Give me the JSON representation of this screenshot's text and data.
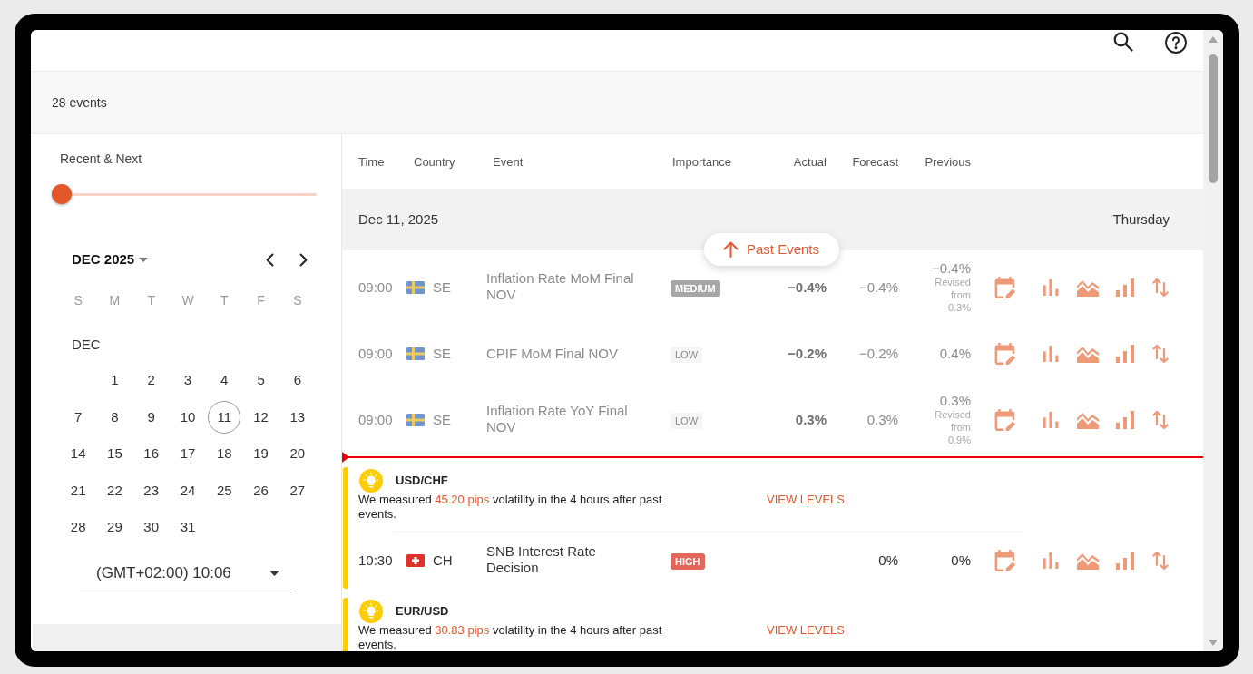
{
  "summary": {
    "event_count": "28 events"
  },
  "sidebar": {
    "range_label": "Recent & Next",
    "range_slider": {
      "level": 0
    },
    "calendar": {
      "month_title": "DEC 2025",
      "weekdays": [
        "S",
        "M",
        "T",
        "W",
        "T",
        "F",
        "S"
      ],
      "month_label": "DEC",
      "weeks": [
        {
          "days": [
            {
              "label": "1",
              "selected": false
            },
            {
              "label": "2",
              "selected": false
            },
            {
              "label": "3",
              "selected": false
            },
            {
              "label": "4",
              "selected": false
            },
            {
              "label": "5",
              "selected": false
            },
            {
              "label": "6",
              "selected": false
            }
          ]
        },
        {
          "days": [
            {
              "label": "7",
              "selected": false
            },
            {
              "label": "8",
              "selected": false
            },
            {
              "label": "9",
              "selected": false
            },
            {
              "label": "10",
              "selected": false
            },
            {
              "label": "11",
              "selected": true
            },
            {
              "label": "12",
              "selected": false
            },
            {
              "label": "13",
              "selected": false
            }
          ]
        },
        {
          "days": [
            {
              "label": "14",
              "selected": false
            },
            {
              "label": "15",
              "selected": false
            },
            {
              "label": "16",
              "selected": false
            },
            {
              "label": "17",
              "selected": false
            },
            {
              "label": "18",
              "selected": false
            },
            {
              "label": "19",
              "selected": false
            },
            {
              "label": "20",
              "selected": false
            }
          ]
        },
        {
          "days": [
            {
              "label": "21",
              "selected": false
            },
            {
              "label": "22",
              "selected": false
            },
            {
              "label": "23",
              "selected": false
            },
            {
              "label": "24",
              "selected": false
            },
            {
              "label": "25",
              "selected": false
            },
            {
              "label": "26",
              "selected": false
            },
            {
              "label": "27",
              "selected": false
            }
          ]
        },
        {
          "days": [
            {
              "label": "28",
              "selected": false
            },
            {
              "label": "29",
              "selected": false
            },
            {
              "label": "30",
              "selected": false
            },
            {
              "label": "31",
              "selected": false
            }
          ]
        }
      ]
    },
    "timezone": {
      "value": "(GMT+02:00) 10:06"
    }
  },
  "table": {
    "columns": [
      "Time",
      "Country",
      "Event",
      "Importance",
      "Actual",
      "Forecast",
      "Previous"
    ],
    "date_group": {
      "date": "Dec 11, 2025",
      "weekday": "Thursday"
    },
    "past_events_button": {
      "label": "Past Events"
    },
    "rows": [
      {
        "kind": "event",
        "past": true,
        "time": "09:00",
        "flag": {
          "kind": "sweden"
        },
        "country": "SE",
        "event": "Inflation Rate MoM Final NOV",
        "importance": {
          "label": "MEDIUM",
          "kind": "medium"
        },
        "actual": "−0.4%",
        "forecast": "−0.4%",
        "previous": "−0.4%",
        "revised_note": "Revised from 0.3%"
      },
      {
        "kind": "event",
        "past": true,
        "time": "09:00",
        "flag": {
          "kind": "sweden"
        },
        "country": "SE",
        "event": "CPIF MoM Final NOV",
        "importance": {
          "label": "LOW",
          "kind": "low"
        },
        "actual": "−0.2%",
        "forecast": "−0.2%",
        "previous": "0.4%"
      },
      {
        "kind": "event",
        "past": true,
        "time": "09:00",
        "flag": {
          "kind": "sweden"
        },
        "country": "SE",
        "event": "Inflation Rate YoY Final NOV",
        "importance": {
          "label": "LOW",
          "kind": "low"
        },
        "actual": "0.3%",
        "forecast": "0.3%",
        "previous": "0.3%",
        "revised_note": "Revised from 0.9%"
      },
      {
        "kind": "now_marker"
      },
      {
        "kind": "volatility_alert",
        "pair": "USD/CHF",
        "message": {
          "before": "We measured ",
          "highlight": "45.20 pips",
          "after": " volatility in the 4 hours after past events."
        },
        "link": "VIEW LEVELS",
        "events": [
          {
            "kind": "event",
            "past": false,
            "time": "10:30",
            "flag": {
              "kind": "switzerland"
            },
            "country": "CH",
            "event": "SNB Interest Rate Decision",
            "importance": {
              "label": "HIGH",
              "kind": "high"
            },
            "forecast": "0%",
            "previous": "0%"
          }
        ]
      },
      {
        "kind": "volatility_alert",
        "pair": "EUR/USD",
        "message": {
          "before": "We measured ",
          "highlight": "30.83 pips",
          "after": " volatility in the 4 hours after past events."
        },
        "link": "VIEW LEVELS"
      }
    ]
  }
}
